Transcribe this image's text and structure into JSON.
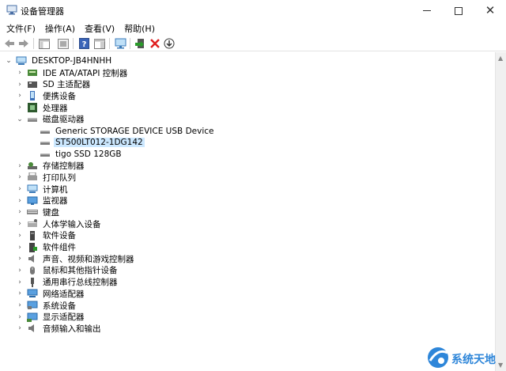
{
  "window": {
    "title": "设备管理器"
  },
  "menu": [
    "文件(F)",
    "操作(A)",
    "查看(V)",
    "帮助(H)"
  ],
  "tree": {
    "root": "DESKTOP-JB4HNHH",
    "items": [
      {
        "label": "IDE ATA/ATAPI 控制器",
        "icon": "ide-controller-icon",
        "expanded": false
      },
      {
        "label": "SD 主适配器",
        "icon": "sd-host-icon",
        "expanded": false
      },
      {
        "label": "便携设备",
        "icon": "portable-device-icon",
        "expanded": false
      },
      {
        "label": "处理器",
        "icon": "processor-icon",
        "expanded": false
      },
      {
        "label": "磁盘驱动器",
        "icon": "disk-drive-icon",
        "expanded": true,
        "children": [
          {
            "label": "Generic STORAGE DEVICE USB Device",
            "icon": "disk-icon",
            "selected": false
          },
          {
            "label": "ST500LT012-1DG142",
            "icon": "disk-icon",
            "selected": true
          },
          {
            "label": "tigo SSD 128GB",
            "icon": "disk-icon",
            "selected": false
          }
        ]
      },
      {
        "label": "存储控制器",
        "icon": "storage-controller-icon",
        "expanded": false
      },
      {
        "label": "打印队列",
        "icon": "printer-icon",
        "expanded": false
      },
      {
        "label": "计算机",
        "icon": "computer-icon",
        "expanded": false
      },
      {
        "label": "监视器",
        "icon": "monitor-icon",
        "expanded": false
      },
      {
        "label": "键盘",
        "icon": "keyboard-icon",
        "expanded": false
      },
      {
        "label": "人体学输入设备",
        "icon": "hid-icon",
        "expanded": false
      },
      {
        "label": "软件设备",
        "icon": "software-device-icon",
        "expanded": false
      },
      {
        "label": "软件组件",
        "icon": "software-component-icon",
        "expanded": false
      },
      {
        "label": "声音、视频和游戏控制器",
        "icon": "sound-icon",
        "expanded": false
      },
      {
        "label": "鼠标和其他指针设备",
        "icon": "mouse-icon",
        "expanded": false
      },
      {
        "label": "通用串行总线控制器",
        "icon": "usb-icon",
        "expanded": false
      },
      {
        "label": "网络适配器",
        "icon": "network-adapter-icon",
        "expanded": false
      },
      {
        "label": "系统设备",
        "icon": "system-device-icon",
        "expanded": false
      },
      {
        "label": "显示适配器",
        "icon": "display-adapter-icon",
        "expanded": false
      },
      {
        "label": "音频输入和输出",
        "icon": "audio-io-icon",
        "expanded": false
      }
    ]
  },
  "watermark": {
    "text": "系统天地"
  },
  "colors": {
    "selection": "#cce8ff",
    "accent": "#2e86d9",
    "remove": "#e02020",
    "green": "#2a9a2a"
  }
}
